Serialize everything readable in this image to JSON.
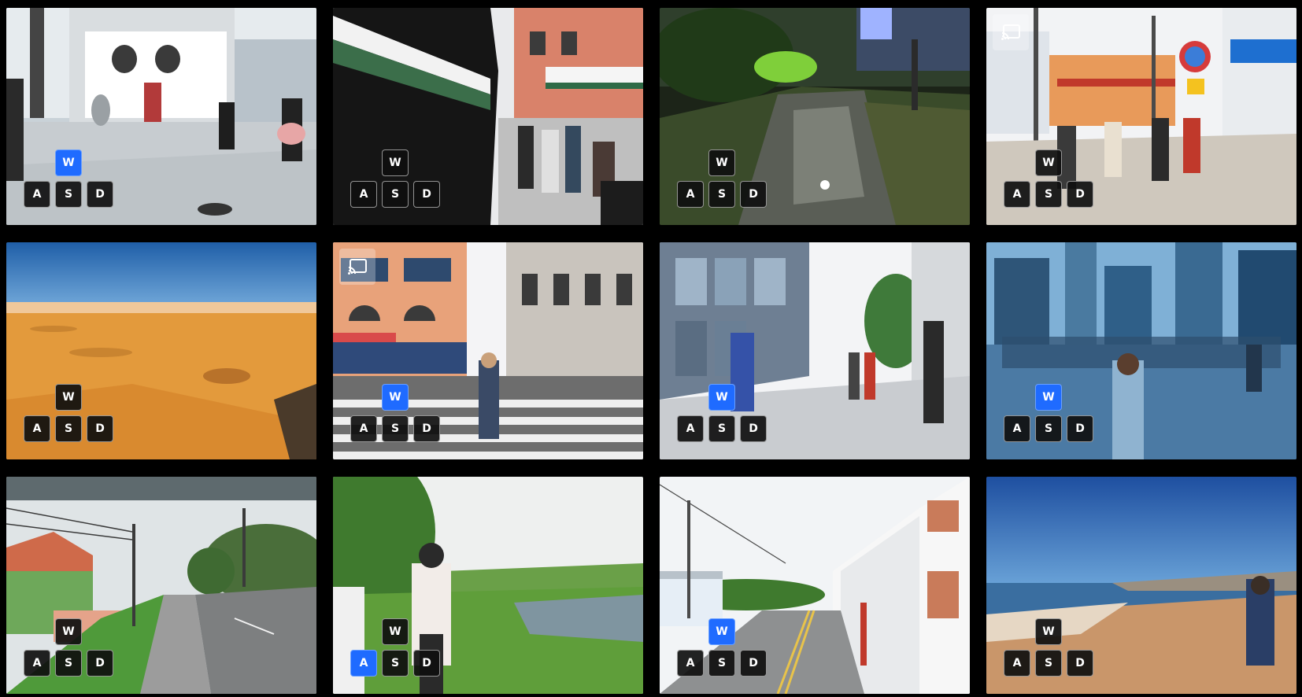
{
  "keys": {
    "w": "W",
    "a": "A",
    "s": "S",
    "d": "D"
  },
  "colors": {
    "background": "#000000",
    "key_idle": "#0f0f0f",
    "key_active": "#1f6bff",
    "key_border": "#ffffff"
  },
  "tiles": [
    {
      "scene": "city-plaza-white-building",
      "active_key": "W",
      "cast_icon": false
    },
    {
      "scene": "street-tram-sidewalk",
      "active_key": "",
      "cast_icon": false
    },
    {
      "scene": "night-flooded-path",
      "active_key": "",
      "cast_icon": false
    },
    {
      "scene": "shopping-street-signs",
      "active_key": "",
      "cast_icon": true
    },
    {
      "scene": "desert-dunes",
      "active_key": "",
      "cast_icon": false
    },
    {
      "scene": "crosswalk-city",
      "active_key": "W",
      "cast_icon": true
    },
    {
      "scene": "glass-building-walkway",
      "active_key": "W",
      "cast_icon": false
    },
    {
      "scene": "blue-city-crowd",
      "active_key": "W",
      "cast_icon": false
    },
    {
      "scene": "rural-road-storm",
      "active_key": "",
      "cast_icon": false
    },
    {
      "scene": "green-field-pond",
      "active_key": "A",
      "cast_icon": false
    },
    {
      "scene": "coastal-road-building",
      "active_key": "W",
      "cast_icon": false
    },
    {
      "scene": "beach-pier",
      "active_key": "",
      "cast_icon": false
    }
  ],
  "icons": {
    "cast": "cast-icon"
  }
}
